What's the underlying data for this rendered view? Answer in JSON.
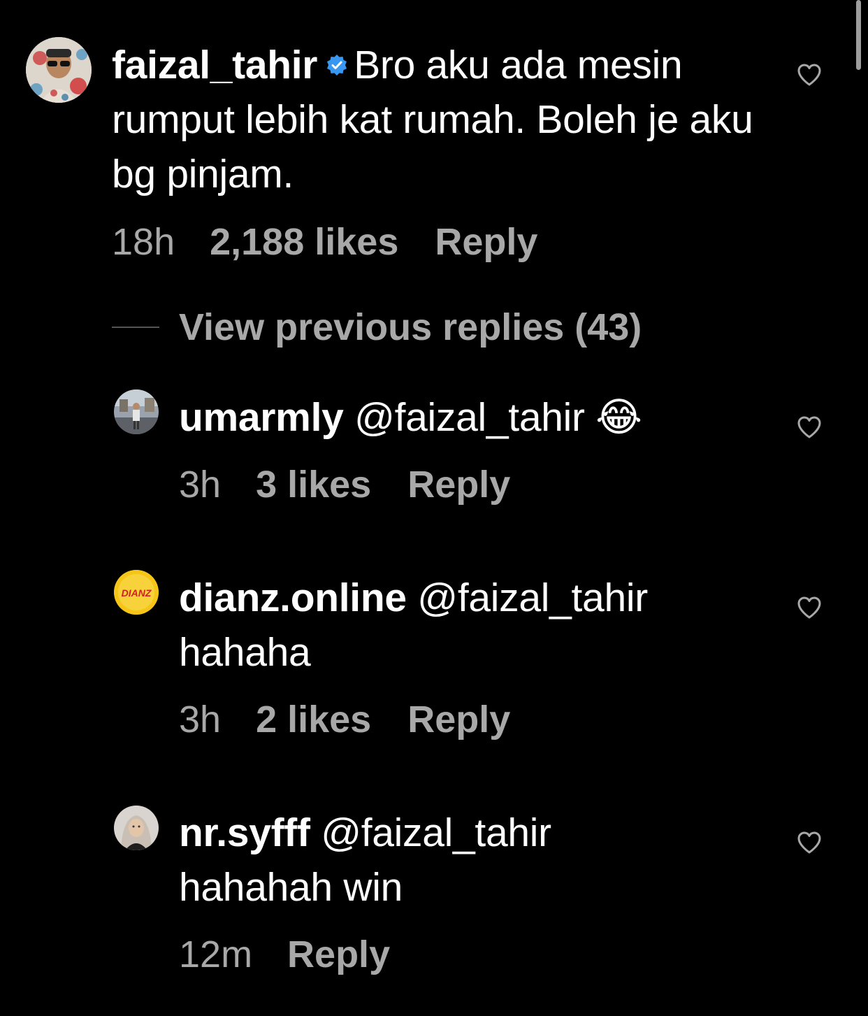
{
  "comments": [
    {
      "username": "faizal_tahir",
      "verified": true,
      "text": "Bro aku ada mesin rumput lebih kat rumah. Boleh je aku bg pinjam.",
      "time": "18h",
      "likes": "2,188 likes",
      "reply": "Reply"
    }
  ],
  "view_replies": {
    "label": "View previous replies (43)"
  },
  "replies": [
    {
      "username": "umarmly",
      "mention": "@faizal_tahir",
      "text": "",
      "emoji": "😂",
      "time": "3h",
      "likes": "3 likes",
      "reply": "Reply"
    },
    {
      "username": "dianz.online",
      "mention": "@faizal_tahir",
      "text": "hahaha",
      "time": "3h",
      "likes": "2 likes",
      "reply": "Reply",
      "avatar_text": "DIANZ"
    },
    {
      "username": "nr.syfff",
      "mention": "@faizal_tahir",
      "text": "hahahah win",
      "time": "12m",
      "likes": "",
      "reply": "Reply"
    }
  ],
  "colors": {
    "background": "#000000",
    "primary_text": "#ffffff",
    "secondary_text": "#a8a8a8",
    "verified_badge": "#3897f0",
    "avatar_dianz": "#f5c518"
  }
}
